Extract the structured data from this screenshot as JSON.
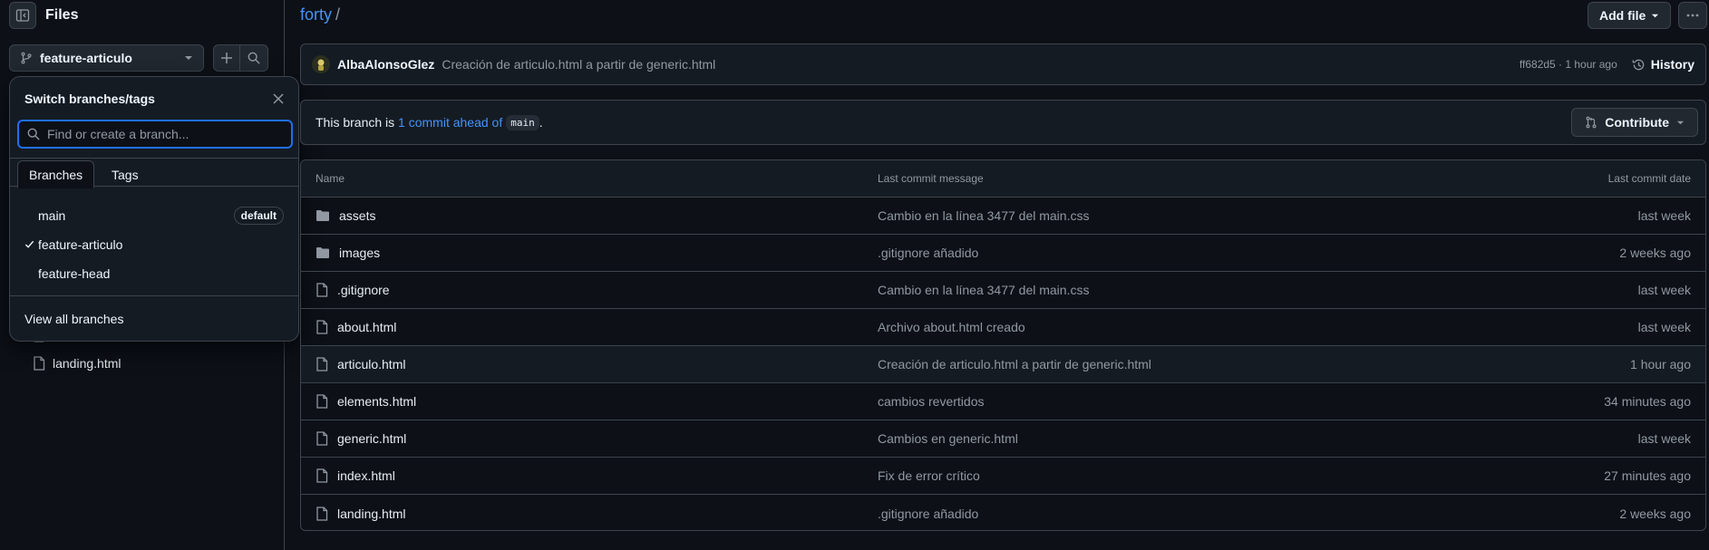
{
  "sidebar": {
    "title": "Files",
    "branch": "feature-articulo",
    "partial_file": "landing.html"
  },
  "branch_popover": {
    "title": "Switch branches/tags",
    "search_placeholder": "Find or create a branch...",
    "tabs": [
      "Branches",
      "Tags"
    ],
    "branches": [
      {
        "name": "main",
        "badge": "default",
        "selected": false
      },
      {
        "name": "feature-articulo",
        "badge": "",
        "selected": true
      },
      {
        "name": "feature-head",
        "badge": "",
        "selected": false
      }
    ],
    "view_all": "View all branches"
  },
  "header": {
    "repo": "forty",
    "separator": "/",
    "add_file": "Add file",
    "more": "···"
  },
  "latest_commit": {
    "author": "AlbaAlonsoGlez",
    "message": "Creación de articulo.html a partir de generic.html",
    "hash_time": "ff682d5 · 1 hour ago",
    "history": "History"
  },
  "ahead": {
    "prefix": "This branch is",
    "link": "1 commit ahead of",
    "base": "main",
    "suffix": ".",
    "contribute": "Contribute"
  },
  "table": {
    "headers": {
      "name": "Name",
      "message": "Last commit message",
      "date": "Last commit date"
    },
    "rows": [
      {
        "name": "assets",
        "type": "folder",
        "message": "Cambio en la línea 3477 del main.css",
        "date": "last week"
      },
      {
        "name": "images",
        "type": "folder",
        "message": ".gitignore añadido",
        "date": "2 weeks ago"
      },
      {
        "name": ".gitignore",
        "type": "file",
        "message": "Cambio en la línea 3477 del main.css",
        "date": "last week"
      },
      {
        "name": "about.html",
        "type": "file",
        "message": "Archivo about.html creado",
        "date": "last week"
      },
      {
        "name": "articulo.html",
        "type": "file",
        "message": "Creación de articulo.html a partir de generic.html",
        "date": "1 hour ago"
      },
      {
        "name": "elements.html",
        "type": "file",
        "message": "cambios revertidos",
        "date": "34 minutes ago"
      },
      {
        "name": "generic.html",
        "type": "file",
        "message": "Cambios en generic.html",
        "date": "last week"
      },
      {
        "name": "index.html",
        "type": "file",
        "message": "Fix de error crítico",
        "date": "27 minutes ago"
      },
      {
        "name": "landing.html",
        "type": "file",
        "message": ".gitignore añadido",
        "date": "2 weeks ago"
      }
    ]
  },
  "colors": {
    "bg": "#0d1117",
    "border": "#3d444d",
    "link": "#4493f8",
    "focus": "#1f6feb"
  }
}
